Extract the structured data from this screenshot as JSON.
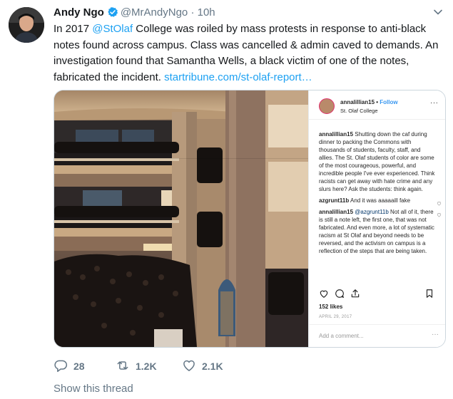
{
  "tweet": {
    "display_name": "Andy Ngo",
    "handle": "@MrAndyNgo",
    "separator": "·",
    "time": "10h",
    "text": {
      "p1": "In 2017 ",
      "mention": "@StOlaf",
      "p2": " College was roiled by mass protests in response to anti-black notes found across campus. Class was cancelled & admin caved to demands. An investigation found that Samantha Wells, a black victim of one of the notes, fabricated the incident. ",
      "link": "startribune.com/st-olaf-report…"
    },
    "stats": {
      "replies": "28",
      "retweets": "1.2K",
      "likes": "2.1K"
    },
    "show_thread": "Show this thread"
  },
  "instagram": {
    "username": "annalillian15",
    "follow_sep": " • ",
    "follow": "Follow",
    "location": "St. Olaf College",
    "caption_user": "annalillian15",
    "caption": " Shutting down the caf during dinner to packing the Commons with thousands of students, faculty, staff, and allies. The St. Olaf students of color are some of the most courageous, powerful, and incredible people I've ever experienced. Think racists can get away with hate crime and any slurs here? Ask the students: think again.",
    "c1_user": "azgrunt11b",
    "c1_text": " And it was aaaaaill fake",
    "c2_user": "annalillian15",
    "c2_mention": "@azgrunt11b",
    "c2_text": " Not all of it, there is still a note left, the first one, that was not fabricated. And even more, a lot of systematic racism at St Olaf and beyond needs to be reversed, and the activism on campus is a reflection of the steps that are being taken.",
    "likes": "152 likes",
    "date": "APRIL 29, 2017",
    "add_comment": "Add a comment...",
    "menu": "···",
    "more": "···"
  },
  "colors": {
    "accent": "#1da1f2",
    "secondary_text": "#657786",
    "ig_link": "#3897f0"
  },
  "icons": [
    "verified-badge-icon",
    "chevron-down-icon",
    "reply-icon",
    "retweet-icon",
    "like-icon",
    "share-icon",
    "ig-heart-icon",
    "ig-comment-icon",
    "ig-share-icon",
    "ig-bookmark-icon"
  ]
}
